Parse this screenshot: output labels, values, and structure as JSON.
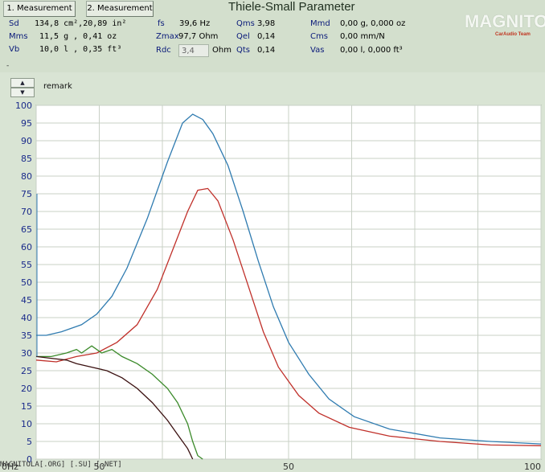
{
  "tabs": [
    {
      "label": "1. Measurement"
    },
    {
      "label": "2. Measurement"
    }
  ],
  "title": "Thiele-Small Parameter",
  "logo": {
    "text": "MAGNITOLA",
    "sub": "CarAudio Team"
  },
  "params": {
    "sd": {
      "label": "Sd",
      "value": "134,8 cm²,20,89 in²"
    },
    "mms": {
      "label": "Mms",
      "value": "11,5 g  , 0,41 oz"
    },
    "vb": {
      "label": "Vb",
      "value": "10,0 l  , 0,35 ft³"
    },
    "fs": {
      "label": "fs",
      "value": "39,6 Hz"
    },
    "zmax": {
      "label": "Zmax",
      "value": "97,7 Ohm"
    },
    "rdc": {
      "label": "Rdc",
      "value": "3,4",
      "unit": "Ohm"
    },
    "qms": {
      "label": "Qms",
      "value": "3,98"
    },
    "qel": {
      "label": "Qel",
      "value": "0,14"
    },
    "qts": {
      "label": "Qts",
      "value": "0,14"
    },
    "mmd": {
      "label": "Mmd",
      "value": "0,00 g, 0,000 oz"
    },
    "cms": {
      "label": "Cms",
      "value": "0,00 mm/N"
    },
    "vas": {
      "label": "Vas",
      "value": "0,00 l, 0,000 ft³"
    }
  },
  "dash_marker": "-",
  "remark": "remark",
  "spin": {
    "up": "▲",
    "down": "▼"
  },
  "footer": "MAGNITOLA[.ORG] [.SU] [.NET]",
  "colors": {
    "impedance": "#2f7bb0",
    "curve_red": "#c0302a",
    "curve_green": "#3b8a2a",
    "curve_dark": "#3a1010",
    "grid": "#c8d0c6",
    "axis_label": "#1a2a8a"
  },
  "chart_data": {
    "type": "line",
    "ylim": [
      0,
      100
    ],
    "xlim": [
      0,
      100
    ],
    "y_ticks": [
      "0",
      "5",
      "10",
      "15",
      "20",
      "25",
      "30",
      "35",
      "40",
      "45",
      "50",
      "55",
      "60",
      "65",
      "70",
      "75",
      "80",
      "85",
      "90",
      "95",
      "100"
    ],
    "x_tick_labels": [
      {
        "x": 0,
        "label": "0Hz"
      },
      {
        "x": 12.5,
        "label": "50"
      },
      {
        "x": 50,
        "label": "50"
      },
      {
        "x": 100,
        "label": "100"
      }
    ],
    "series": [
      {
        "key": "impedance",
        "points": [
          [
            0,
            35
          ],
          [
            2,
            35
          ],
          [
            5,
            36
          ],
          [
            9,
            38
          ],
          [
            12,
            41
          ],
          [
            15,
            46
          ],
          [
            18,
            54
          ],
          [
            22,
            68
          ],
          [
            26,
            84
          ],
          [
            29,
            95
          ],
          [
            31,
            97.5
          ],
          [
            33,
            96
          ],
          [
            35,
            92
          ],
          [
            38,
            83
          ],
          [
            41,
            70
          ],
          [
            44,
            56
          ],
          [
            47,
            43
          ],
          [
            50,
            33
          ],
          [
            54,
            24
          ],
          [
            58,
            17
          ],
          [
            63,
            12
          ],
          [
            70,
            8.5
          ],
          [
            80,
            6
          ],
          [
            90,
            5
          ],
          [
            100,
            4.3
          ]
        ]
      },
      {
        "key": "curve_red",
        "points": [
          [
            0,
            28
          ],
          [
            4,
            27.5
          ],
          [
            8,
            29
          ],
          [
            12,
            30
          ],
          [
            16,
            33
          ],
          [
            20,
            38
          ],
          [
            24,
            48
          ],
          [
            27,
            59
          ],
          [
            30,
            70
          ],
          [
            32,
            76
          ],
          [
            34,
            76.5
          ],
          [
            36,
            73
          ],
          [
            39,
            62
          ],
          [
            42,
            49
          ],
          [
            45,
            36
          ],
          [
            48,
            26
          ],
          [
            52,
            18
          ],
          [
            56,
            13
          ],
          [
            62,
            9
          ],
          [
            70,
            6.5
          ],
          [
            80,
            5
          ],
          [
            90,
            4
          ],
          [
            100,
            3.8
          ]
        ]
      },
      {
        "key": "curve_green",
        "points": [
          [
            0,
            29
          ],
          [
            3,
            29
          ],
          [
            6,
            30
          ],
          [
            8,
            31
          ],
          [
            9,
            30
          ],
          [
            11,
            32
          ],
          [
            13,
            30
          ],
          [
            15,
            31
          ],
          [
            17,
            29
          ],
          [
            20,
            27
          ],
          [
            23,
            24
          ],
          [
            26,
            20
          ],
          [
            28,
            16
          ],
          [
            30,
            10
          ],
          [
            31,
            5
          ],
          [
            32,
            1
          ],
          [
            33,
            0
          ]
        ]
      },
      {
        "key": "curve_dark",
        "points": [
          [
            0,
            29
          ],
          [
            3,
            28.5
          ],
          [
            6,
            28
          ],
          [
            8,
            27
          ],
          [
            11,
            26
          ],
          [
            14,
            25
          ],
          [
            17,
            23
          ],
          [
            20,
            20
          ],
          [
            23,
            16
          ],
          [
            26,
            11
          ],
          [
            28,
            7
          ],
          [
            30,
            3
          ],
          [
            31,
            0
          ]
        ]
      }
    ]
  }
}
